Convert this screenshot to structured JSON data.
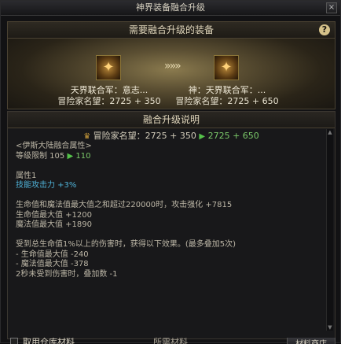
{
  "window": {
    "title": "神界装备融合升级",
    "close_label": "×"
  },
  "top_panel": {
    "header": "需要融合升级的装备",
    "help_label": "?",
    "source_item": {
      "name": "天界联合军：意志...",
      "rep_label": "冒险家名望：2725 + 350",
      "icon": "equipment-icon"
    },
    "arrows": "»»»",
    "target_item": {
      "name": "神：天界联合军：...",
      "rep_label": "冒险家名望：2725 + 650",
      "icon": "equipment-icon"
    }
  },
  "bottom_panel": {
    "header": "融合升级说明",
    "rep_prefix": "冒险家名望：2725 + 350",
    "rep_arrow": "▶",
    "rep_result": "2725 + 650",
    "lines": {
      "l1": "<伊斯大陆融合属性>",
      "l2_prefix": "等级限制 105",
      "l2_arrow": "▶",
      "l2_value": "110",
      "l3": "属性1",
      "l4": "技能攻击力 +3%",
      "l5": "生命值和魔法值最大值之和超过220000时，攻击强化 +7815",
      "l6": "生命值最大值 +1200",
      "l7": "魔法值最大值 +1890",
      "l8": "受到总生命值1%以上的伤害时，获得以下效果。(最多叠加5次)",
      "l9": "- 生命值最大值 -240",
      "l10": "- 魔法值最大值 -378",
      "l11": "2秒未受到伤害时，叠加数 -1"
    }
  },
  "footer": {
    "checkbox_label": "取用仓库材料",
    "mid_label": "所需材料",
    "shop_button": "材料商店"
  },
  "colors": {
    "accent_gold": "#c99b3a",
    "green_arrow": "#55c24a",
    "skill_stat": "#4fb3d9"
  }
}
